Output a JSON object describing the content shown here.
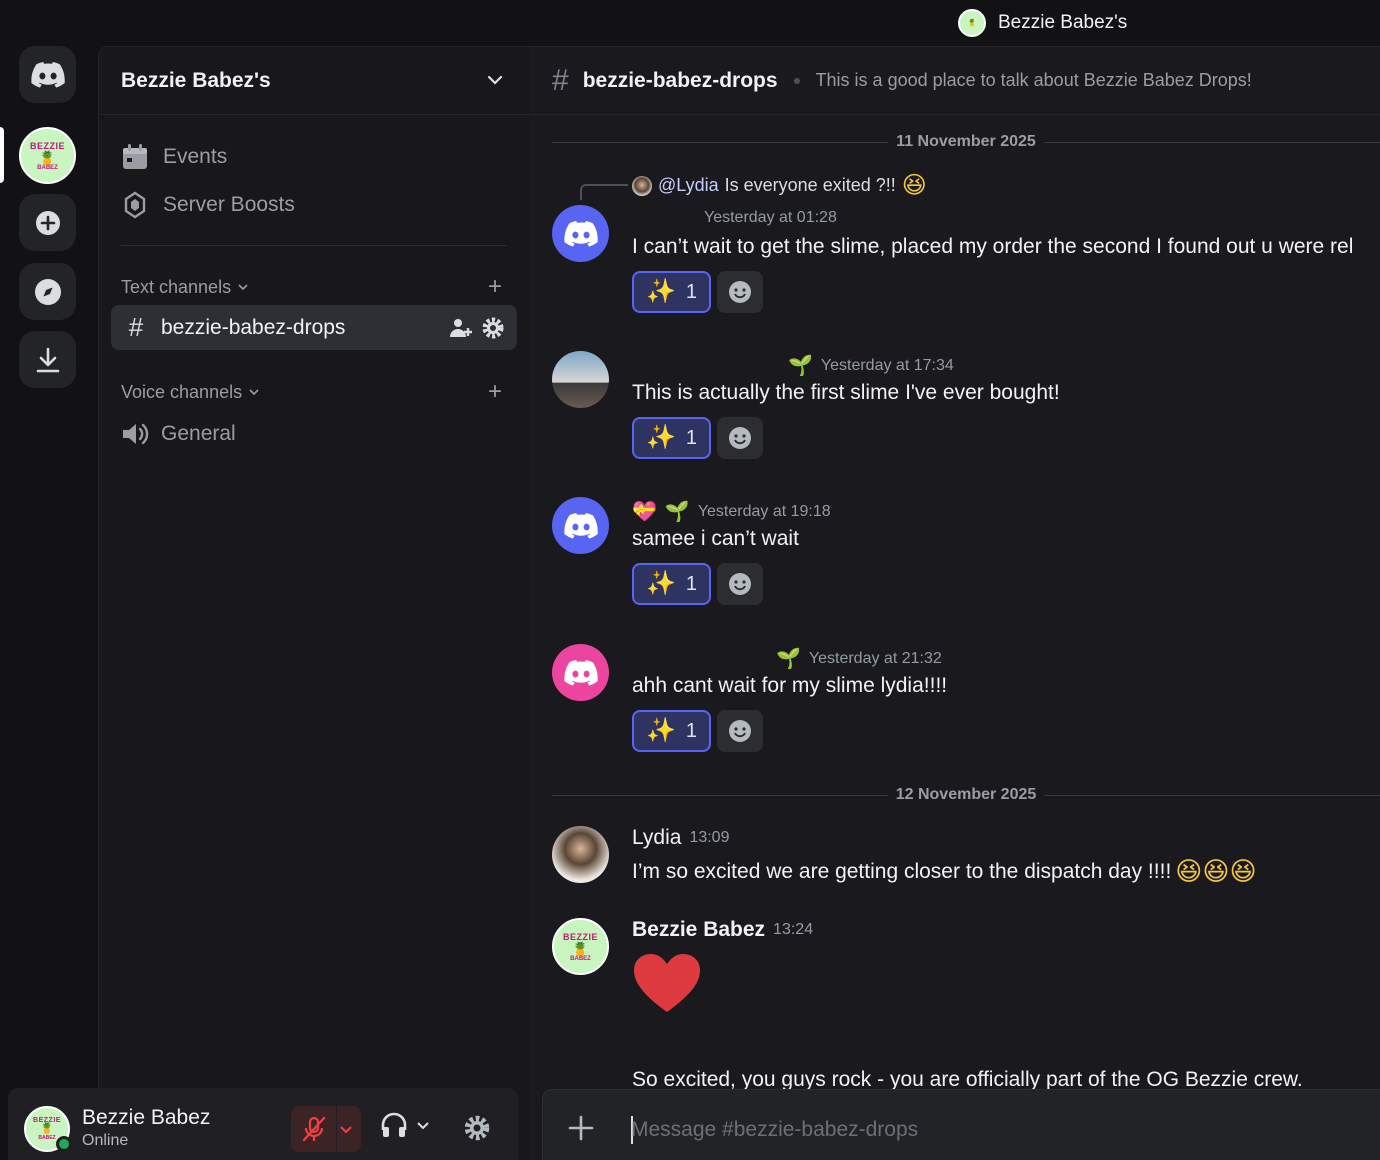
{
  "titlebar": {
    "server_name": "Bezzie Babez's"
  },
  "server_badge": {
    "top": "BEZZIE",
    "fruit": "🍍",
    "bottom": "BABEZ"
  },
  "sidebar": {
    "server_name": "Bezzie Babez's",
    "items": [
      {
        "label": "Events",
        "icon": "calendar-icon"
      },
      {
        "label": "Server Boosts",
        "icon": "boost-icon"
      }
    ],
    "text_category": "Text channels",
    "active_channel": "bezzie-babez-drops",
    "voice_category": "Voice channels",
    "voice_channel": "General"
  },
  "user_panel": {
    "name": "Bezzie Babez",
    "status": "Online"
  },
  "channel": {
    "name": "bezzie-babez-drops",
    "topic": "This is a good place to talk about Bezzie Babez Drops!"
  },
  "dates": [
    "11 November 2025",
    "12 November 2025"
  ],
  "messages": [
    {
      "reply_mention": "@Lydia",
      "reply_text": "Is everyone exited ?!!",
      "reply_emoji": "😆",
      "timestamp": "Yesterday at 01:28",
      "text": "I can’t wait to get the slime, placed my order the second I found out u were rel",
      "reaction_emoji": "✨",
      "reaction_count": "1"
    },
    {
      "badge": "🌱",
      "timestamp": "Yesterday at 17:34",
      "text": "This is actually the first slime I've ever bought!",
      "reaction_emoji": "✨",
      "reaction_count": "1"
    },
    {
      "badge1": "💝",
      "badge2": "🌱",
      "timestamp": "Yesterday at 19:18",
      "text": "samee i can’t wait",
      "reaction_emoji": "✨",
      "reaction_count": "1"
    },
    {
      "badge": "🌱",
      "timestamp": "Yesterday at 21:32",
      "text": "ahh cant wait for my slime lydia!!!!",
      "reaction_emoji": "✨",
      "reaction_count": "1"
    },
    {
      "username": "Lydia",
      "timestamp": "13:09",
      "text": "I’m so excited we are getting closer to the dispatch day !!!!",
      "emojis": "😆😆😆"
    },
    {
      "username": "Bezzie Babez",
      "timestamp": "13:24",
      "text": "So excited, you guys rock - you are officially part of the OG Bezzie crew."
    }
  ],
  "composer": {
    "placeholder": "Message #bezzie-babez-drops"
  },
  "colors": {
    "accent": "#5865f2",
    "pink": "#eb459f",
    "online": "#23a55a",
    "muted_bg": "#3b2326"
  }
}
